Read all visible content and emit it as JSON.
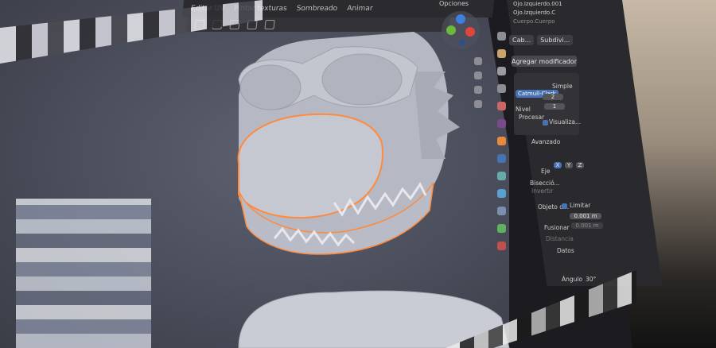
{
  "header": {
    "tabs": [
      "Editar UV",
      "Pintar texturas",
      "Sombreado",
      "Animar"
    ],
    "options_label": "Opciones"
  },
  "outliner": {
    "items": [
      "Ojo.Izquierdo.001",
      "Ojo.Izquierdo.C",
      "Cuerpo.Cuerpo"
    ]
  },
  "properties": {
    "object_name": "Cab...",
    "modifier_name": "Subdivi...",
    "add_modifier_label": "Agregar modificador",
    "subdivision": {
      "catmull_label": "Catmull-Clark",
      "simple_label": "Simple",
      "nivel_label": "Nivel",
      "nivel_value": "2",
      "procesar_label": "Procesar",
      "procesar_value": "1",
      "visualizar_label": "Visualiza..."
    },
    "avanzado_label": "Avanzado",
    "mirror": {
      "eje_label": "Eje",
      "biseccion_label": "Bisecció...",
      "invertir_label": "Invertir",
      "axis_x": "X",
      "axis_y": "Y",
      "axis_z": "Z",
      "objeto_label": "Objeto d...",
      "limitar_label": "Limitar",
      "fusionar_label": "Fusionar",
      "fusionar_value": "0.001 m",
      "distance_label": "Distancia",
      "distance_value": "0.001 m"
    },
    "datos_label": "Datos",
    "angulo_label": "Ángulo",
    "angulo_value": "30°"
  },
  "colors": {
    "accent_blue": "#4772b3",
    "selection_orange": "#ff8a3d",
    "axis_red": "#e0463c",
    "axis_green": "#6cb83a",
    "axis_blue": "#3f7fe0"
  }
}
